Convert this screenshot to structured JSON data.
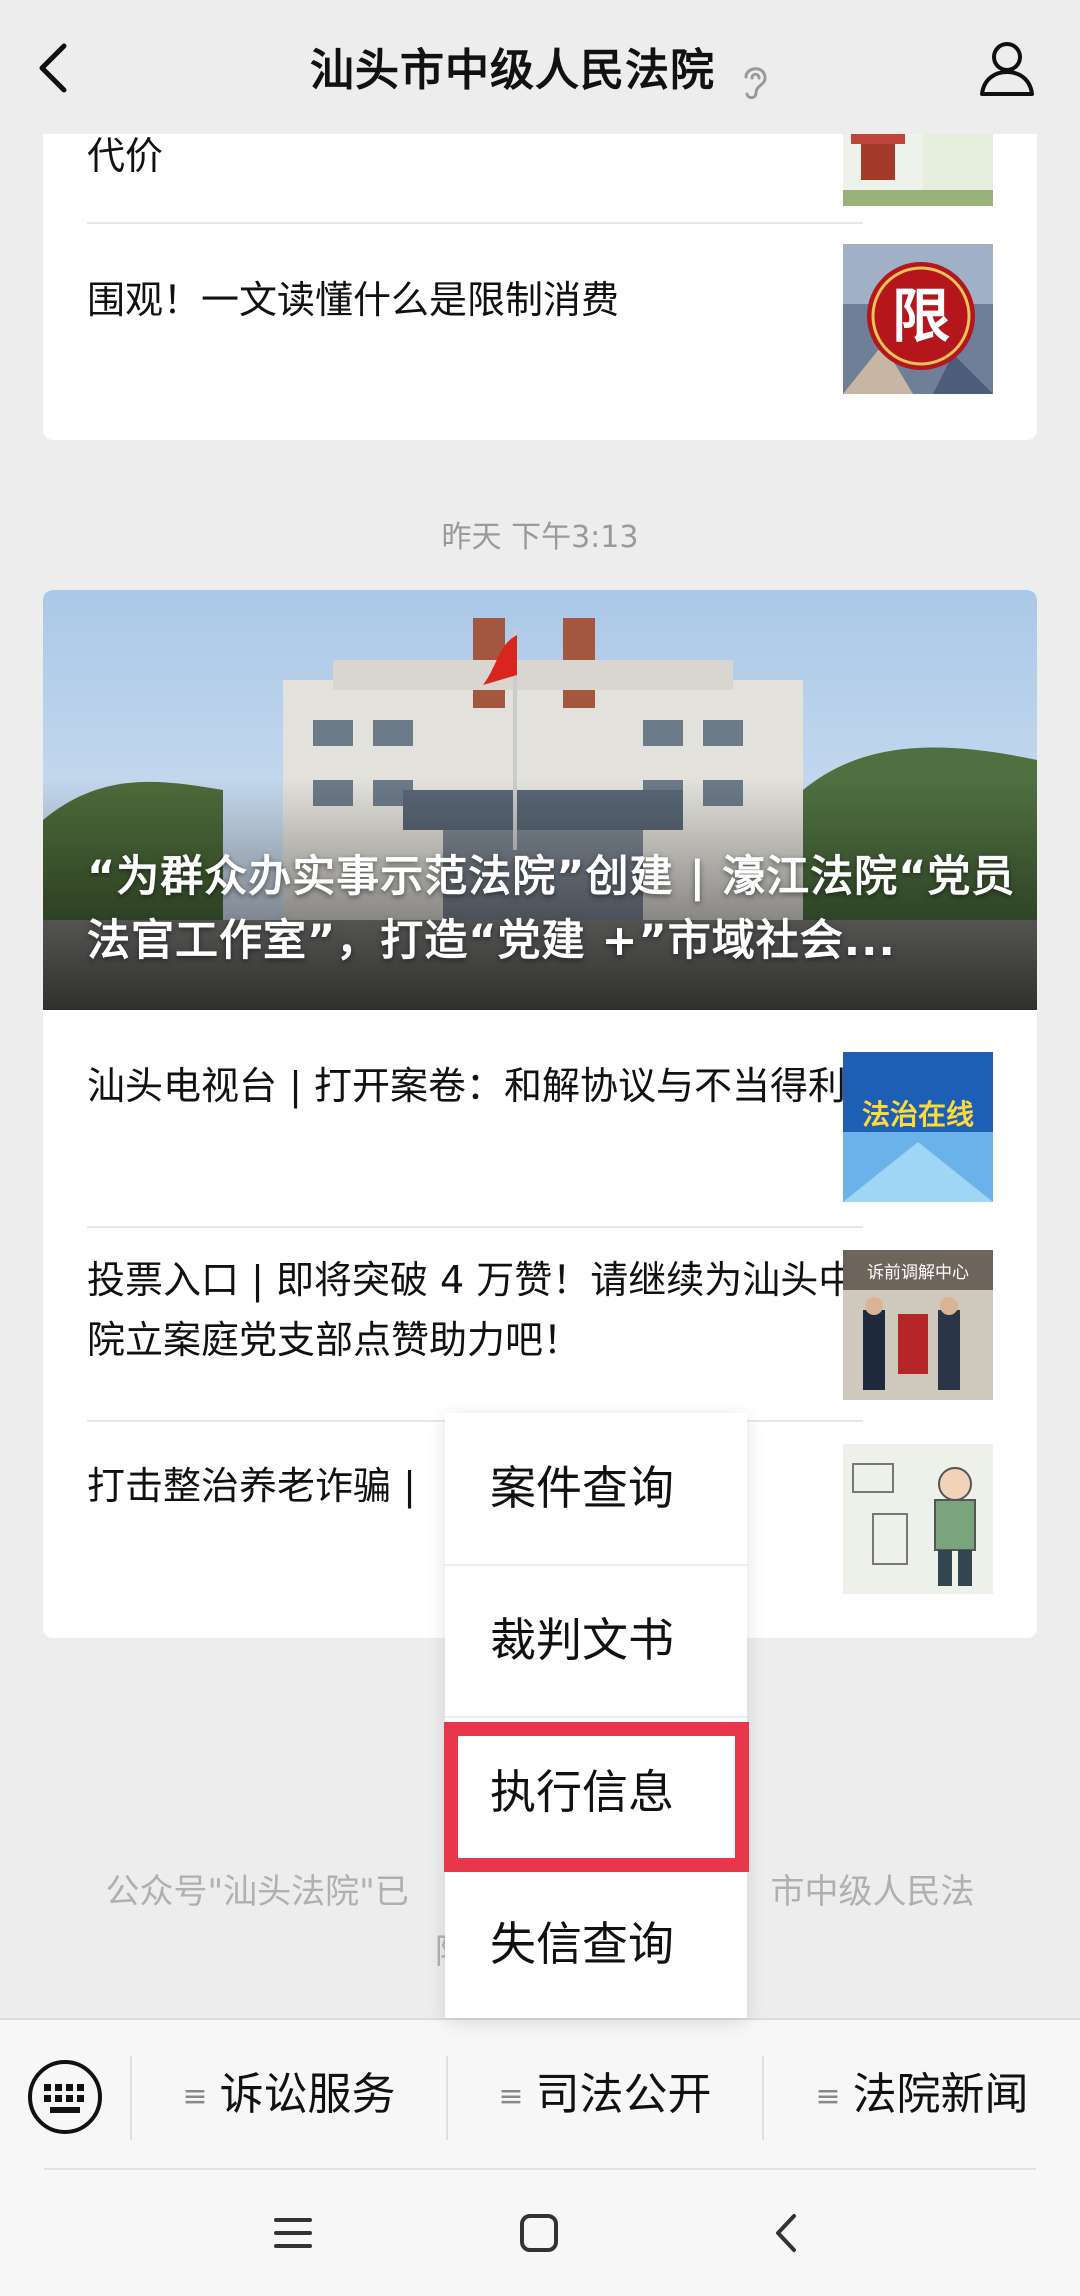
{
  "header": {
    "title": "汕头市中级人民法院"
  },
  "first_card": {
    "articles": [
      {
        "title": "代价"
      },
      {
        "title": "围观！一文读懂什么是限制消费",
        "thumb_text": "限"
      }
    ]
  },
  "timestamp": "昨天 下午3:13",
  "second_card": {
    "cover_title": "“为群众办实事示范法院”创建 | 濠江法院“党员法官工作室”，打造“党建 +”市域社会...",
    "articles": [
      {
        "title": "汕头电视台 | 打开案卷：和解协议与不当得利",
        "thumb_text": "法治在线"
      },
      {
        "title": "投票入口 | 即将突破 4 万赞！请继续为汕头中院立案庭党支部点赞助力吧！",
        "thumb_text": "诉前调解中心"
      },
      {
        "title": "打击整治养老诈骗 |"
      }
    ]
  },
  "footer_note": {
    "line1_left": "公众号\"汕头法院\"已",
    "line1_right": "市中级人民法",
    "line2": "院"
  },
  "popup_menu": {
    "items": [
      "案件查询",
      "裁判文书",
      "执行信息",
      "失信查询"
    ],
    "highlighted_index": 2,
    "highlight_color": "#e8374a"
  },
  "bottom_menu": {
    "items": [
      "诉讼服务",
      "司法公开",
      "法院新闻"
    ]
  },
  "colors": {
    "background": "#ededed",
    "card": "#ffffff",
    "highlight": "#e8374a"
  }
}
